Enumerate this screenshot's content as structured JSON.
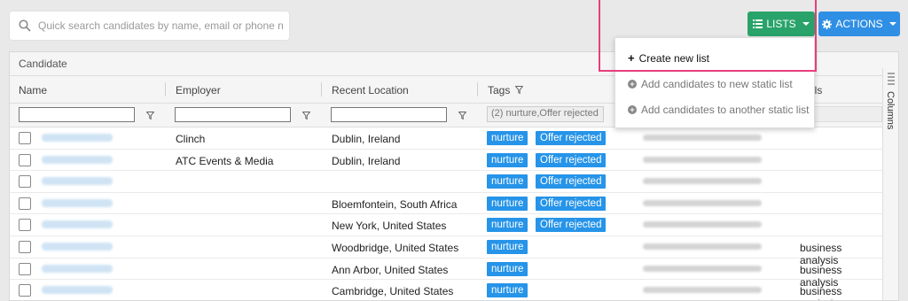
{
  "search": {
    "placeholder": "Quick search candidates by name, email or phone number"
  },
  "toolbar": {
    "lists_label": "LISTS",
    "actions_label": "ACTIONS"
  },
  "dropdown": {
    "items": [
      {
        "label": "Create new list"
      },
      {
        "label": "Add candidates to new static list"
      },
      {
        "label": "Add candidates to another static list"
      }
    ]
  },
  "panel": {
    "title": "Candidate"
  },
  "columns": {
    "name": "Name",
    "employer": "Employer",
    "location": "Recent Location",
    "tags": "Tags",
    "skills_partial": "lls"
  },
  "filters": {
    "tags_value": "(2) nurture,Offer rejected"
  },
  "side_tab": {
    "label": "Columns"
  },
  "rows": [
    {
      "employer": "Clinch",
      "location": "Dublin, Ireland",
      "tags": [
        "nurture",
        "Offer rejected"
      ],
      "skill": ""
    },
    {
      "employer": "ATC Events & Media",
      "location": "Dublin, Ireland",
      "tags": [
        "nurture",
        "Offer rejected"
      ],
      "skill": ""
    },
    {
      "employer": "",
      "location": "",
      "tags": [
        "nurture",
        "Offer rejected"
      ],
      "skill": ""
    },
    {
      "employer": "",
      "location": "Bloemfontein, South Africa",
      "tags": [
        "nurture",
        "Offer rejected"
      ],
      "skill": ""
    },
    {
      "employer": "",
      "location": "New York, United States",
      "tags": [
        "nurture",
        "Offer rejected"
      ],
      "skill": ""
    },
    {
      "employer": "",
      "location": "Woodbridge, United States",
      "tags": [
        "nurture"
      ],
      "skill": "business analysis"
    },
    {
      "employer": "",
      "location": "Ann Arbor, United States",
      "tags": [
        "nurture"
      ],
      "skill": "business analysis"
    },
    {
      "employer": "",
      "location": "Cambridge, United States",
      "tags": [
        "nurture"
      ],
      "skill": "business analysis"
    }
  ],
  "colors": {
    "lists_button": "#29a36a",
    "actions_button": "#2f8fe4",
    "tag": "#2694e8",
    "highlight": "#e63f7c"
  },
  "icons": {
    "search": "search-icon",
    "lists": "list-icon",
    "actions": "gear-icon",
    "filter": "funnel-icon"
  }
}
